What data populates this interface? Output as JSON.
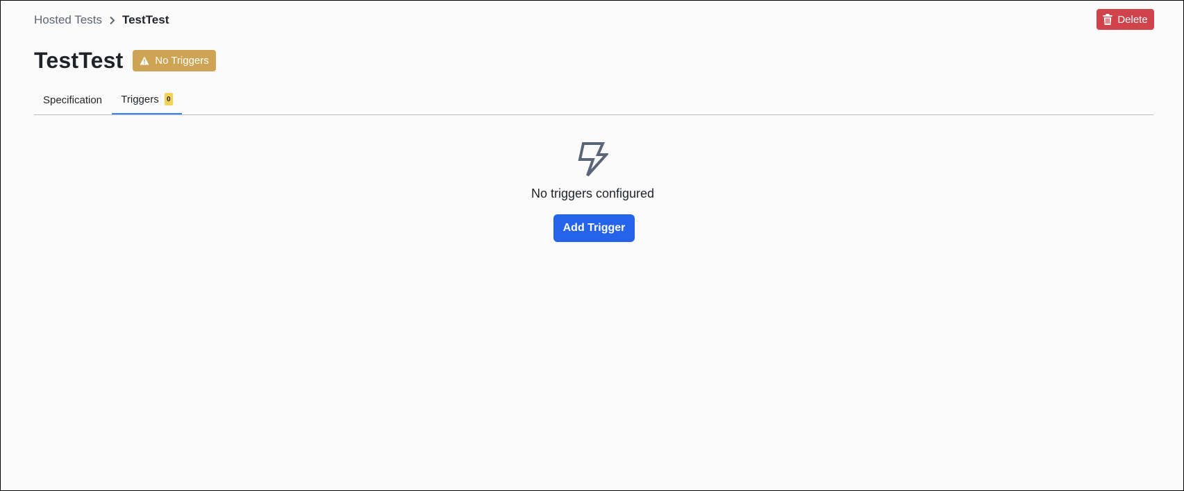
{
  "breadcrumb": {
    "parent": "Hosted Tests",
    "current": "TestTest"
  },
  "header": {
    "title": "TestTest",
    "status_badge": "No Triggers",
    "delete_label": "Delete"
  },
  "tabs": [
    {
      "label": "Specification",
      "active": false
    },
    {
      "label": "Triggers",
      "count": "0",
      "active": true
    }
  ],
  "empty_state": {
    "icon": "lightning-bolt-icon",
    "message": "No triggers configured",
    "action_label": "Add Trigger"
  },
  "colors": {
    "delete": "#d1434b",
    "status_badge": "#cda354",
    "primary": "#2563eb",
    "tab_active": "#3b82f6",
    "count_badge": "#f7d154"
  }
}
